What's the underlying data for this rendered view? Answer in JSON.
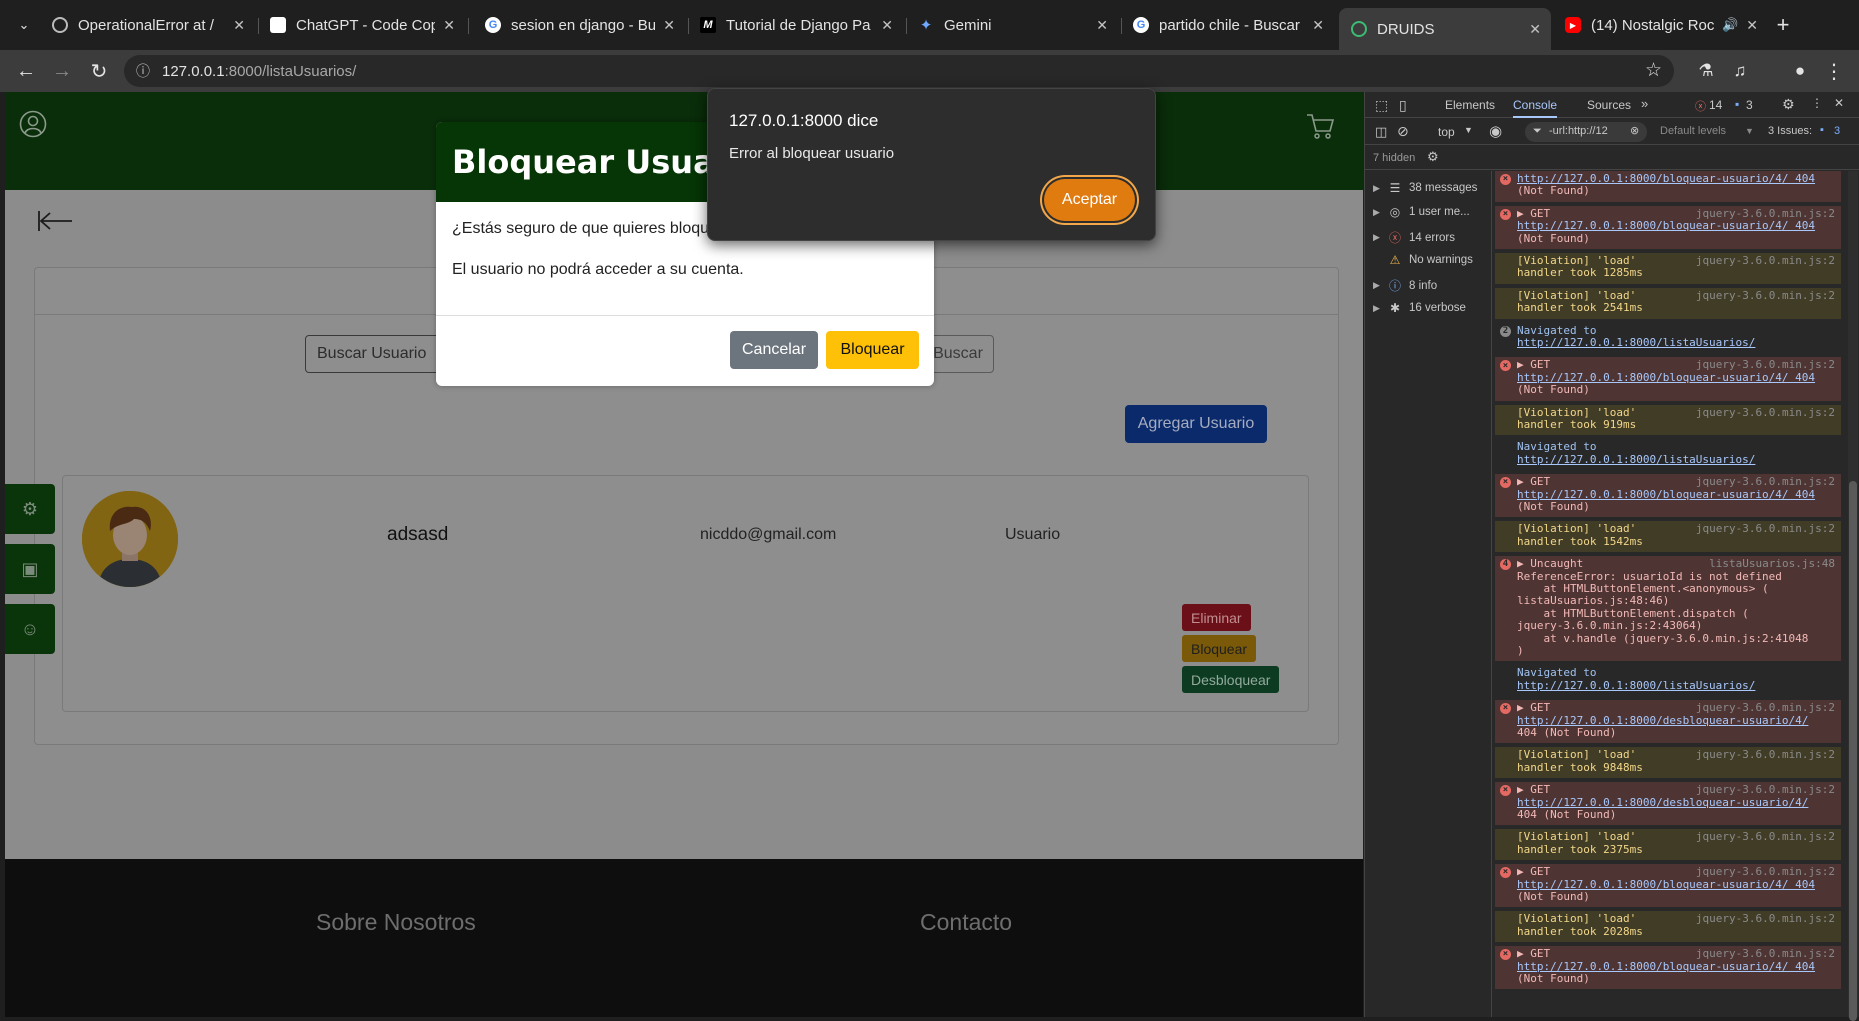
{
  "tabs": [
    {
      "title": "OperationalError at /",
      "icon": "globe-icon"
    },
    {
      "title": "ChatGPT - Code Copilo",
      "icon": "chatgpt-icon"
    },
    {
      "title": "sesion en django - Bus",
      "icon": "google-icon"
    },
    {
      "title": "Tutorial de Django Pa",
      "icon": "m-icon"
    },
    {
      "title": "Gemini",
      "icon": "gemini-icon"
    },
    {
      "title": "partido chile - Buscar",
      "icon": "google-icon"
    },
    {
      "title": "DRUIDS",
      "icon": "druids-icon"
    },
    {
      "title": "(14) Nostalgic Roc",
      "icon": "youtube-icon"
    }
  ],
  "url": {
    "host": "127.0.0.1",
    "path": ":8000/listaUsuarios/"
  },
  "page": {
    "search_placeholder": "Buscar Usuario",
    "search_button": "Buscar",
    "add_user": "Agregar Usuario",
    "user": {
      "name": "adsasd",
      "email": "nicddo@gmail.com",
      "role": "Usuario"
    },
    "actions": {
      "delete": "Eliminar",
      "block": "Bloquear",
      "unblock": "Desbloquear"
    },
    "footer": {
      "about": "Sobre Nosotros",
      "contact": "Contacto"
    }
  },
  "modal": {
    "title": "Bloquear Usuario",
    "question": "¿Estás seguro de que quieres bloquear a este usuario?",
    "warning": "El usuario no podrá acceder a su cuenta.",
    "cancel": "Cancelar",
    "confirm": "Bloquear"
  },
  "alert": {
    "title": "127.0.0.1:8000 dice",
    "message": "Error al bloquear usuario",
    "ok": "Aceptar"
  },
  "devtools": {
    "tabs": [
      "Elements",
      "Console",
      "Sources"
    ],
    "active_tab": "Console",
    "error_count": "14",
    "info_count": "3",
    "context": "top",
    "filter": "-url:http://12",
    "levels": "Default levels",
    "issues_label": "3 Issues:",
    "issues_count": "3",
    "hidden": "7 hidden",
    "sidebar": [
      "38 messages",
      "1 user me...",
      "14 errors",
      "No warnings",
      "8 info",
      "16 verbose"
    ]
  },
  "console": [
    {
      "type": "err",
      "lines": [
        "http://127.0.0.1:8000/bloquear-usuario/4/ 404",
        "(Not Found)"
      ],
      "src": ""
    },
    {
      "type": "err",
      "lines": [
        "▶ GET",
        "http://127.0.0.1:8000/bloquear-usuario/4/ 404",
        "(Not Found)"
      ],
      "src": "jquery-3.6.0.min.js:2"
    },
    {
      "type": "warn",
      "lines": [
        "[Violation] 'load'",
        "handler took 1285ms"
      ],
      "src": "jquery-3.6.0.min.js:2"
    },
    {
      "type": "warn",
      "lines": [
        "[Violation] 'load'",
        "handler took 2541ms"
      ],
      "src": "jquery-3.6.0.min.js:2"
    },
    {
      "type": "nav",
      "lines": [
        "Navigated to",
        "http://127.0.0.1:8000/listaUsuarios/"
      ],
      "src": "",
      "badge": "2"
    },
    {
      "type": "err",
      "lines": [
        "▶ GET",
        "http://127.0.0.1:8000/bloquear-usuario/4/ 404",
        "(Not Found)"
      ],
      "src": "jquery-3.6.0.min.js:2"
    },
    {
      "type": "warn",
      "lines": [
        "[Violation] 'load'",
        "handler took 919ms"
      ],
      "src": "jquery-3.6.0.min.js:2"
    },
    {
      "type": "nav",
      "lines": [
        "Navigated to",
        "http://127.0.0.1:8000/listaUsuarios/"
      ],
      "src": ""
    },
    {
      "type": "err",
      "lines": [
        "▶ GET",
        "http://127.0.0.1:8000/bloquear-usuario/4/ 404",
        "(Not Found)"
      ],
      "src": "jquery-3.6.0.min.js:2"
    },
    {
      "type": "warn",
      "lines": [
        "[Violation] 'load'",
        "handler took 1542ms"
      ],
      "src": "jquery-3.6.0.min.js:2"
    },
    {
      "type": "err",
      "lines": [
        "▶ Uncaught",
        "ReferenceError: usuarioId is not defined",
        "    at HTMLButtonElement.<anonymous> (",
        "listaUsuarios.js:48:46)",
        "    at HTMLButtonElement.dispatch (",
        "jquery-3.6.0.min.js:2:43064)",
        "    at v.handle (jquery-3.6.0.min.js:2:41048",
        ")"
      ],
      "src": "listaUsuarios.js:48",
      "badge": "4"
    },
    {
      "type": "nav",
      "lines": [
        "Navigated to",
        "http://127.0.0.1:8000/listaUsuarios/"
      ],
      "src": ""
    },
    {
      "type": "err",
      "lines": [
        "▶ GET",
        "http://127.0.0.1:8000/desbloquear-usuario/4/",
        "404 (Not Found)"
      ],
      "src": "jquery-3.6.0.min.js:2"
    },
    {
      "type": "warn",
      "lines": [
        "[Violation] 'load'",
        "handler took 9848ms"
      ],
      "src": "jquery-3.6.0.min.js:2"
    },
    {
      "type": "err",
      "lines": [
        "▶ GET",
        "http://127.0.0.1:8000/desbloquear-usuario/4/",
        "404 (Not Found)"
      ],
      "src": "jquery-3.6.0.min.js:2"
    },
    {
      "type": "warn",
      "lines": [
        "[Violation] 'load'",
        "handler took 2375ms"
      ],
      "src": "jquery-3.6.0.min.js:2"
    },
    {
      "type": "err",
      "lines": [
        "▶ GET",
        "http://127.0.0.1:8000/bloquear-usuario/4/ 404",
        "(Not Found)"
      ],
      "src": "jquery-3.6.0.min.js:2"
    },
    {
      "type": "warn",
      "lines": [
        "[Violation] 'load'",
        "handler took 2028ms"
      ],
      "src": "jquery-3.6.0.min.js:2"
    },
    {
      "type": "err",
      "lines": [
        "▶ GET",
        "http://127.0.0.1:8000/bloquear-usuario/4/ 404",
        "(Not Found)"
      ],
      "src": "jquery-3.6.0.min.js:2"
    }
  ]
}
